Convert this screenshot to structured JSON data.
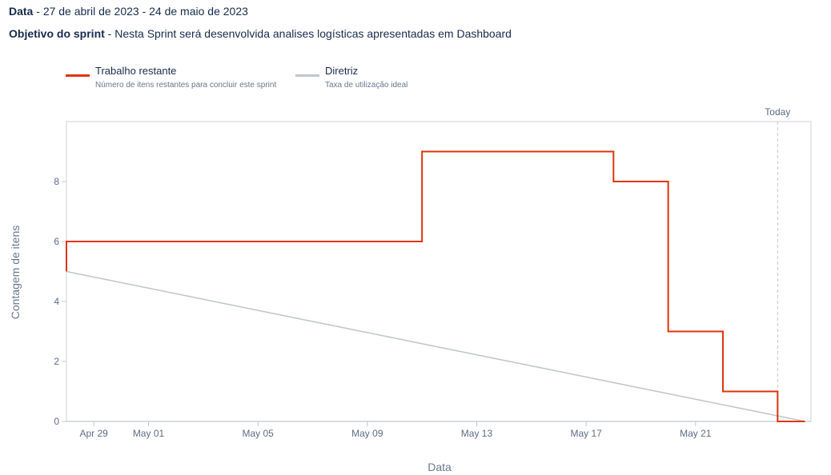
{
  "header": {
    "date_label": "Data",
    "date_value": "27 de abril de 2023 - 24 de maio de 2023",
    "goal_label": "Objetivo do sprint",
    "goal_value": "Nesta Sprint será desenvolvida analises logísticas apresentadas em Dashboard"
  },
  "legend": {
    "remaining": {
      "name": "Trabalho restante",
      "desc": "Número de itens restantes para concluir este sprint",
      "color": "#de350b"
    },
    "guideline": {
      "name": "Diretriz",
      "desc": "Taxa de utilização ideal",
      "color": "#c1c7d0"
    }
  },
  "chart_data": {
    "type": "line",
    "xlabel": "Data",
    "ylabel": "Contagem de itens",
    "today_label": "Today",
    "x_range": [
      "2023-04-27",
      "2023-05-24"
    ],
    "y_range": [
      0,
      10
    ],
    "x_ticks": [
      {
        "date": "2023-04-29",
        "label": "Apr 29"
      },
      {
        "date": "2023-05-01",
        "label": "May 01"
      },
      {
        "date": "2023-05-05",
        "label": "May 05"
      },
      {
        "date": "2023-05-09",
        "label": "May 09"
      },
      {
        "date": "2023-05-13",
        "label": "May 13"
      },
      {
        "date": "2023-05-17",
        "label": "May 17"
      },
      {
        "date": "2023-05-21",
        "label": "May 21"
      }
    ],
    "y_ticks": [
      0,
      2,
      4,
      6,
      8
    ],
    "today": "2023-05-24",
    "series": [
      {
        "name": "Trabalho restante",
        "step": true,
        "points": [
          {
            "x": "2023-04-28",
            "y": 5
          },
          {
            "x": "2023-04-28",
            "y": 6
          },
          {
            "x": "2023-05-11",
            "y": 6
          },
          {
            "x": "2023-05-11",
            "y": 9
          },
          {
            "x": "2023-05-18",
            "y": 9
          },
          {
            "x": "2023-05-18",
            "y": 8
          },
          {
            "x": "2023-05-20",
            "y": 8
          },
          {
            "x": "2023-05-20",
            "y": 3
          },
          {
            "x": "2023-05-22",
            "y": 3
          },
          {
            "x": "2023-05-22",
            "y": 1
          },
          {
            "x": "2023-05-24",
            "y": 1
          },
          {
            "x": "2023-05-24",
            "y": 0
          },
          {
            "x": "2023-05-25",
            "y": 0
          }
        ]
      },
      {
        "name": "Diretriz",
        "step": false,
        "points": [
          {
            "x": "2023-04-28",
            "y": 5
          },
          {
            "x": "2023-05-25",
            "y": 0
          }
        ]
      }
    ]
  }
}
